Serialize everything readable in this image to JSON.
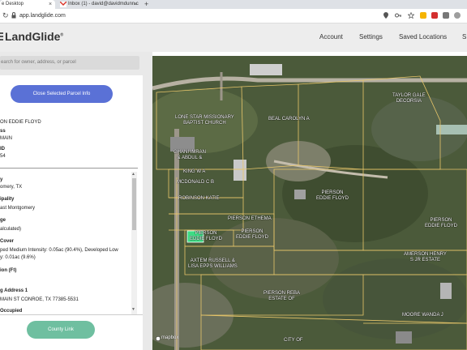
{
  "browser": {
    "tabs": [
      {
        "title": "e Desktop",
        "close": "×"
      },
      {
        "title": "Inbox (1) - david@davidmdunn.c",
        "close": "×"
      }
    ],
    "new_tab": "+",
    "url": "app.landglide.com"
  },
  "header": {
    "logo": "LandGlide",
    "logo_mark": "®",
    "nav": [
      "Account",
      "Settings",
      "Saved Locations",
      "S"
    ]
  },
  "search": {
    "placeholder": "earch for owner, address, or parcel"
  },
  "panel": {
    "close_button": "Close Selected Parcel Info",
    "owner_value": "ON EDDIE FLOYD",
    "addr_label": "ss",
    "addr_value": "MAIN",
    "id_label": "ID",
    "id_value": "54",
    "county_label": "y",
    "county_value": "omery, TX",
    "muni_label": "ipality",
    "muni_value": "ast Montgomery",
    "acre_label": "ge",
    "acre_value": "alculated)",
    "cover_label": "Cover",
    "cover_value1": "ped Medium Intensity: 0.05ac (90.4%), Developed Low",
    "cover_value2": "y: 0.01ac (9.6%)",
    "elev_label": "ion (Ft)",
    "mail_label": "g Address 1",
    "mail_value": "MAIN ST CONROE, TX 77385-5531",
    "occ_label": "Occupied",
    "county_link": "County Link"
  },
  "map": {
    "labels": [
      {
        "text": "LONE STAR MISSIONARY\nBAPTIST CHURCH"
      },
      {
        "text": "BEAL CAROLYN A"
      },
      {
        "text": "TAYLOR GALE\nDECORSIA"
      },
      {
        "text": "GHANI IMRAN\n& ABDUL &"
      },
      {
        "text": "KING W A"
      },
      {
        "text": "MCDONALD C B"
      },
      {
        "text": "ROBINSON KATIE"
      },
      {
        "text": "PIERSON\nEDDIE FLOYD"
      },
      {
        "text": "PIERSON ETHEMA"
      },
      {
        "text": "PIERSON\nEDDIE FLOYD"
      },
      {
        "text": "PIERSON\nEDDIE FLOYD"
      },
      {
        "text": "PIERSON\nEDDIE FLOYD"
      },
      {
        "text": "AXTEM RUSSELL &\nLISA EPPS WILLIAMS"
      },
      {
        "text": "AMERSON HENRY\nS JR ESTATE"
      },
      {
        "text": "PIERSON REBA\nESTATE OF"
      },
      {
        "text": "MOORE WANDA J"
      },
      {
        "text": "CITY OF"
      }
    ],
    "attribution": "mapbox"
  },
  "colors": {
    "close_button": "#5a71d6",
    "county_link": "#6fbfa0",
    "selected_parcel": "#3ddc84",
    "parcel_lines": "#e8c66a"
  }
}
